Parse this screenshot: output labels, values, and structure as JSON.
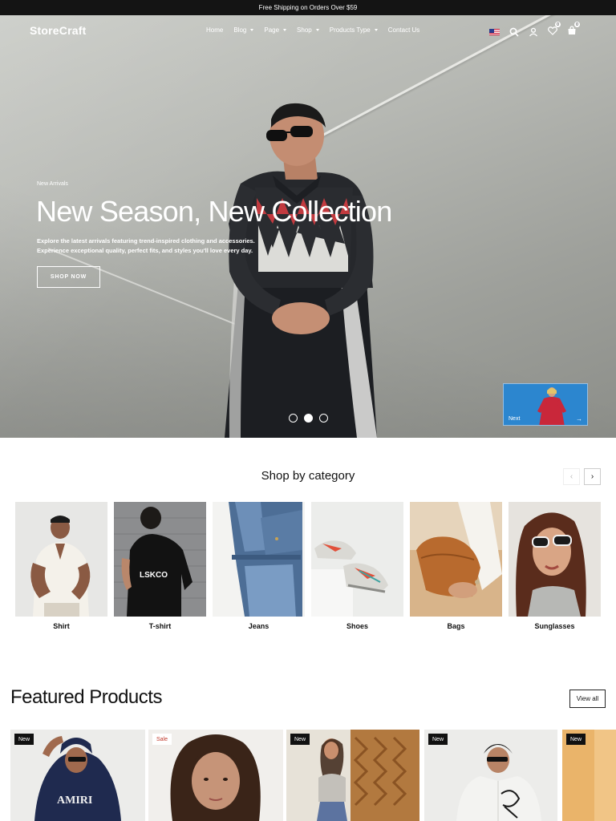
{
  "topbar": {
    "text": "Free Shipping on Orders Over $59"
  },
  "nav": {
    "logo": "StoreCraft",
    "menu": [
      {
        "label": "Home",
        "dropdown": false
      },
      {
        "label": "Blog",
        "dropdown": true
      },
      {
        "label": "Page",
        "dropdown": true
      },
      {
        "label": "Shop",
        "dropdown": true
      },
      {
        "label": "Products Type",
        "dropdown": true
      },
      {
        "label": "Contact Us",
        "dropdown": false
      }
    ],
    "icons": [
      "us-flag-icon",
      "search-icon",
      "user-icon",
      "heart-icon",
      "cart-icon"
    ],
    "wishlist_count": "0",
    "cart_count": "0"
  },
  "hero": {
    "eyebrow": "New Arrivals",
    "title": "New Season, New Collection",
    "description": "Explore the latest arrivals featuring trend-inspired clothing and accessories. Experience exceptional quality, perfect fits, and styles you'll love every day.",
    "cta": "SHOP NOW",
    "slides": 3,
    "active_slide": 2,
    "next_label": "Next"
  },
  "categories": {
    "title": "Shop by category",
    "items": [
      {
        "label": "Shirt"
      },
      {
        "label": "T-shirt"
      },
      {
        "label": "Jeans"
      },
      {
        "label": "Shoes"
      },
      {
        "label": "Bags"
      },
      {
        "label": "Sunglasses"
      }
    ]
  },
  "featured": {
    "title": "Featured Products",
    "view_all": "View all",
    "products": [
      {
        "tag": "New"
      },
      {
        "tag": "Sale"
      },
      {
        "tag": "New"
      },
      {
        "tag": "New"
      },
      {
        "tag": "New"
      }
    ]
  },
  "colors": {
    "accent": "#111111",
    "sale": "#c0392b",
    "topbar": "#141414"
  }
}
